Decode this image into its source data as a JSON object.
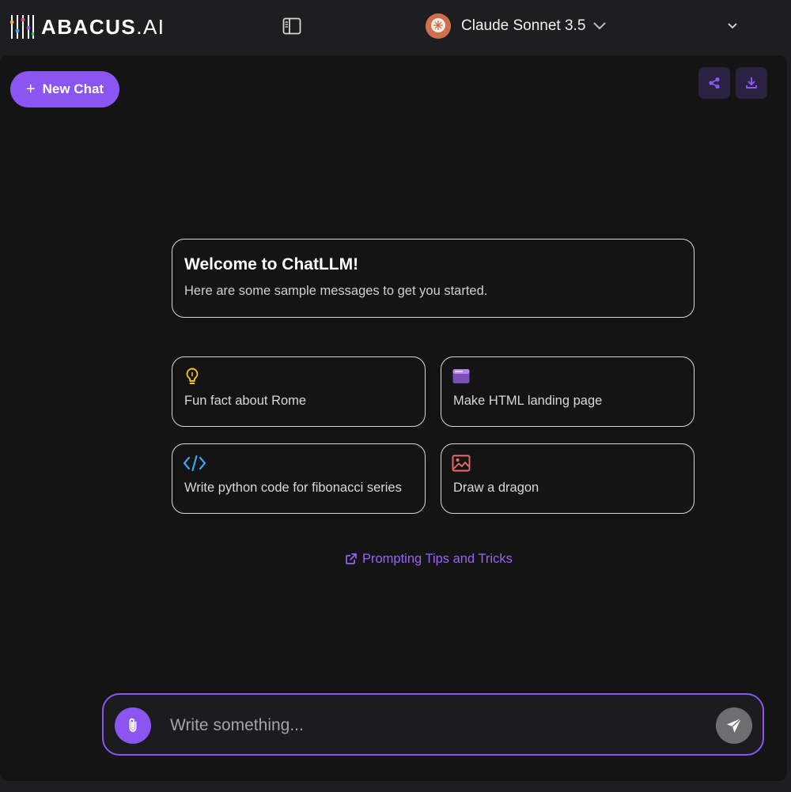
{
  "header": {
    "logo_text_strong": "ABACUS",
    "logo_text_rest": ".AI",
    "model_name": "Claude Sonnet 3.5",
    "icons": {
      "sidebar_toggle": "sidebar-panel-icon",
      "model_avatar": "claude-model-avatar",
      "model_dropdown": "chevron-down-icon",
      "top_dropdown": "chevron-down-icon"
    }
  },
  "toolbar": {
    "new_chat_label": "New Chat",
    "share_icon": "share-icon",
    "download_icon": "download-icon"
  },
  "welcome": {
    "title": "Welcome to ChatLLM!",
    "subtitle": "Here are some sample messages to get you started."
  },
  "suggestions": [
    {
      "label": "Fun fact about Rome",
      "icon": "lightbulb-icon",
      "color": "#f5c518"
    },
    {
      "label": "Make HTML landing page",
      "icon": "browser-window-icon",
      "color": "#a374e0"
    },
    {
      "label": "Write python code for fibonacci series",
      "icon": "code-icon",
      "color": "#3aa8f0"
    },
    {
      "label": "Draw a dragon",
      "icon": "image-icon",
      "color": "#f06a6a"
    }
  ],
  "tips": {
    "label": "Prompting Tips and Tricks",
    "icon": "external-link-icon"
  },
  "composer": {
    "placeholder": "Write something...",
    "value": "",
    "attach_icon": "paperclip-icon",
    "send_icon": "send-icon"
  },
  "colors": {
    "accent": "#8b55f2",
    "background": "#141415",
    "topbar": "#1e1e20",
    "link": "#9b63f5"
  }
}
